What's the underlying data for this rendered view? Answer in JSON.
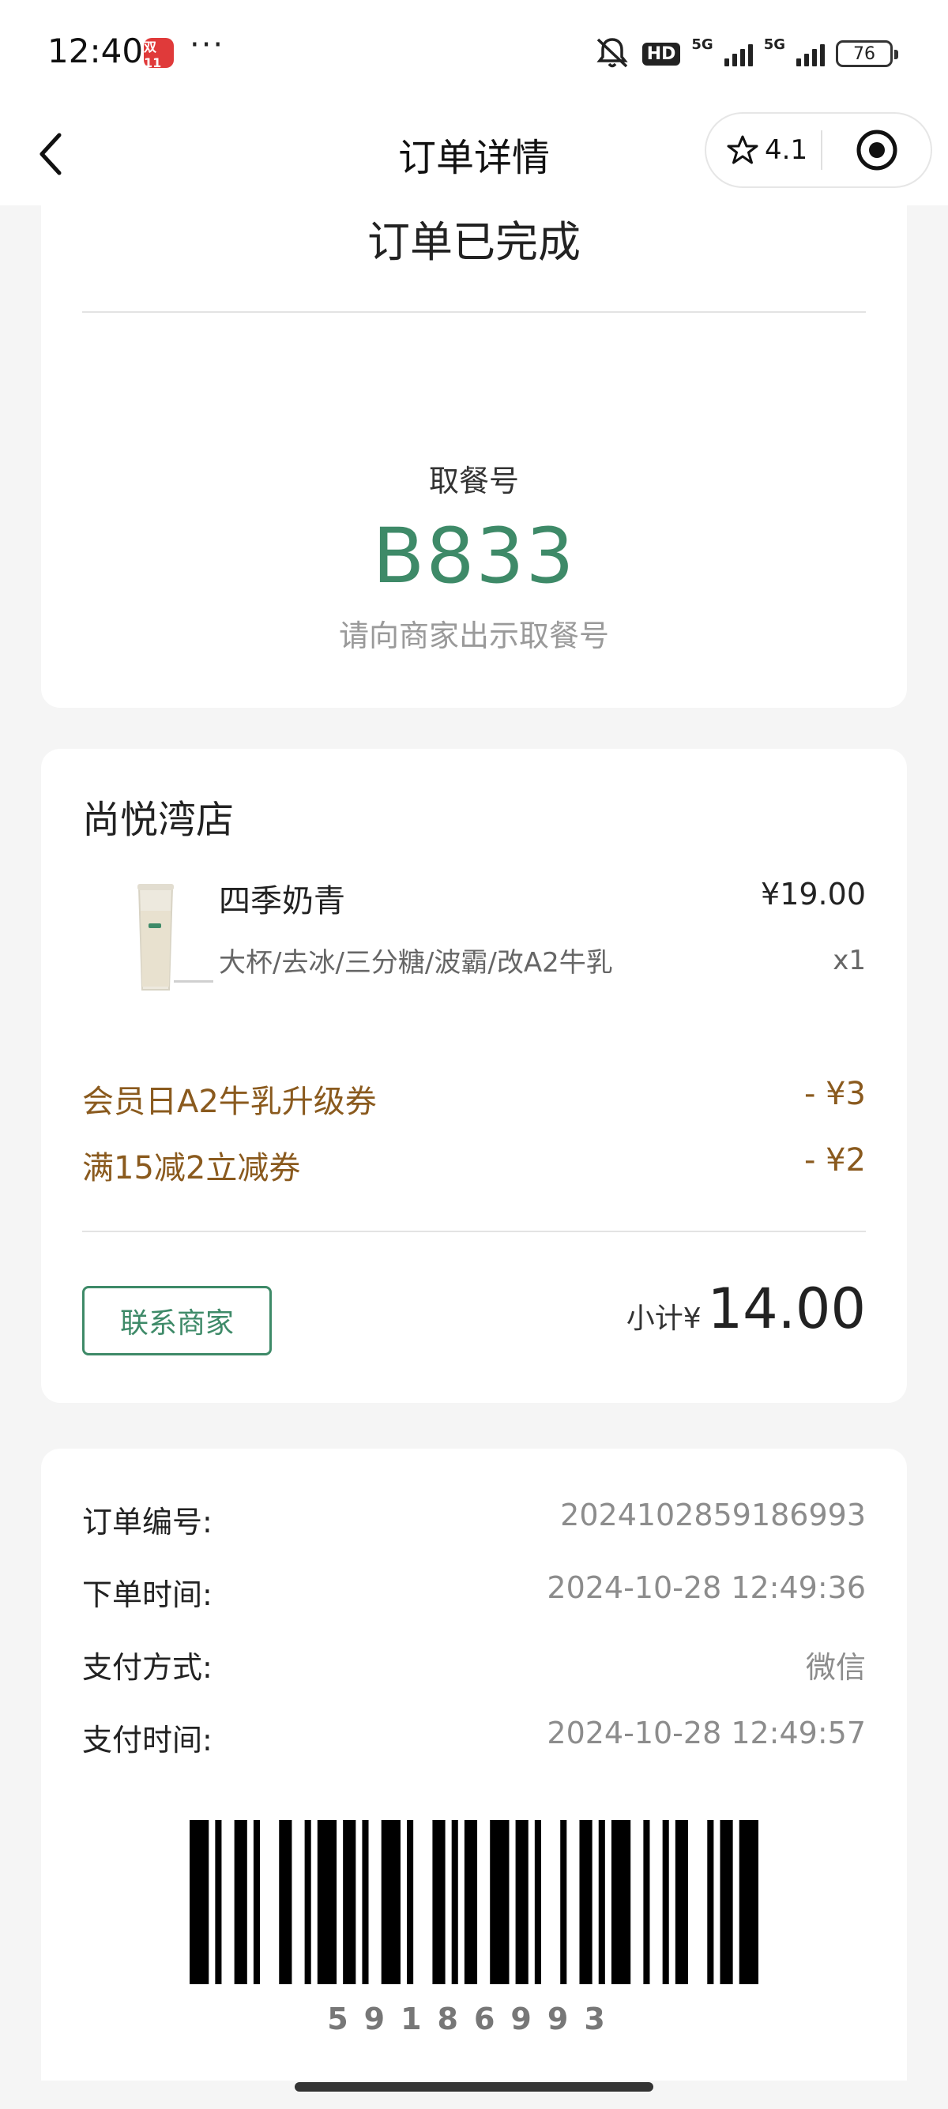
{
  "status_bar": {
    "time": "12:40",
    "more": "···",
    "app_icon": "双11",
    "hd": "HD",
    "network1": "5G",
    "network2": "5G",
    "battery": "76"
  },
  "nav": {
    "title": "订单详情",
    "rating": "4.1"
  },
  "order": {
    "status": "订单已完成",
    "pickup_label": "取餐号",
    "pickup_number": "B833",
    "pickup_hint": "请向商家出示取餐号"
  },
  "store": {
    "name": "尚悦湾店",
    "product": {
      "name": "四季奶青",
      "price": "¥19.00",
      "specs": "大杯/去冰/三分糖/波霸/改A2牛乳",
      "qty": "x1"
    },
    "discounts": [
      {
        "label": "会员日A2牛乳升级券",
        "amount": "- ¥3"
      },
      {
        "label": "满15减2立减券",
        "amount": "- ¥2"
      }
    ],
    "contact_label": "联系商家",
    "subtotal_label": "小计¥",
    "subtotal_value": "14.00"
  },
  "info": {
    "rows": [
      {
        "label": "订单编号:",
        "value": "2024102859186993"
      },
      {
        "label": "下单时间:",
        "value": "2024-10-28 12:49:36"
      },
      {
        "label": "支付方式:",
        "value": "微信"
      },
      {
        "label": "支付时间:",
        "value": "2024-10-28 12:49:57"
      }
    ],
    "barcode_number": "59186993"
  },
  "colors": {
    "accent_green": "#3e8a68",
    "discount_brown": "#8a5a1e"
  }
}
